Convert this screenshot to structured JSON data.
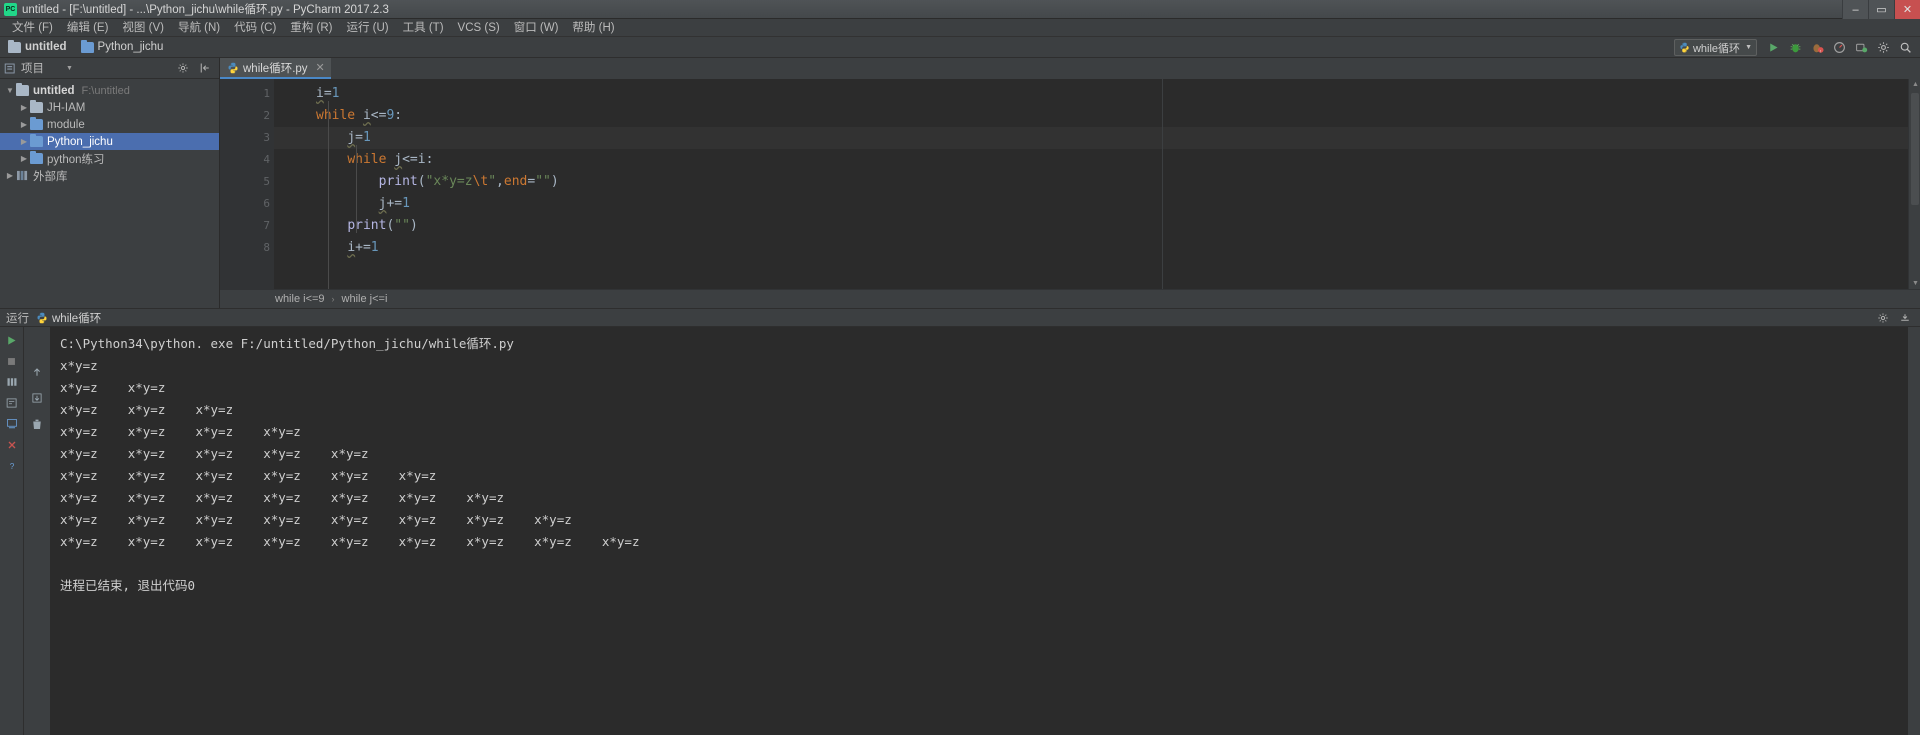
{
  "window": {
    "title": "untitled - [F:\\untitled] - ...\\Python_jichu\\while循环.py - PyCharm 2017.2.3",
    "app_icon": "pycharm-logo-icon",
    "minimize": "–",
    "maximize": "▭",
    "close": "✕"
  },
  "menubar": {
    "items": [
      {
        "label": "文件 (F)",
        "name": "menu-file"
      },
      {
        "label": "编辑 (E)",
        "name": "menu-edit"
      },
      {
        "label": "视图 (V)",
        "name": "menu-view"
      },
      {
        "label": "导航 (N)",
        "name": "menu-navigate"
      },
      {
        "label": "代码 (C)",
        "name": "menu-code"
      },
      {
        "label": "重构 (R)",
        "name": "menu-refactor"
      },
      {
        "label": "运行 (U)",
        "name": "menu-run"
      },
      {
        "label": "工具 (T)",
        "name": "menu-tools"
      },
      {
        "label": "VCS (S)",
        "name": "menu-vcs"
      },
      {
        "label": "窗口 (W)",
        "name": "menu-window"
      },
      {
        "label": "帮助 (H)",
        "name": "menu-help"
      }
    ]
  },
  "navbar": {
    "crumbs": [
      {
        "label": "untitled",
        "icon": "folder-icon"
      },
      {
        "label": "Python_jichu",
        "icon": "source-folder-icon"
      }
    ],
    "run_config": {
      "label": "while循环",
      "icon": "python-file-icon",
      "caret": "▼"
    },
    "actions": [
      {
        "name": "run-button",
        "glyph": "▶"
      },
      {
        "name": "debug-button",
        "glyph": "bug"
      },
      {
        "name": "coverage-button",
        "glyph": "coverage"
      },
      {
        "name": "profile-button",
        "glyph": "profile"
      },
      {
        "name": "attach-button",
        "glyph": "attach"
      },
      {
        "name": "settings-button",
        "glyph": "gear"
      },
      {
        "name": "search-button",
        "glyph": "magnifier"
      }
    ]
  },
  "project_panel": {
    "header": {
      "title": "项目",
      "icon": "project-view-icon",
      "caret": "▼",
      "gear": "⚙",
      "collapse": "⇥"
    },
    "tree": [
      {
        "label": "untitled",
        "sub": "F:\\untitled",
        "icon": "folder-icon",
        "arrow": "▼",
        "depth": 0,
        "selected": false,
        "bold": true
      },
      {
        "label": "JH-IAM",
        "sub": "",
        "icon": "folder-icon",
        "arrow": "▶",
        "depth": 1,
        "selected": false,
        "bold": false
      },
      {
        "label": "module",
        "sub": "",
        "icon": "source-folder-icon",
        "arrow": "▶",
        "depth": 1,
        "selected": false,
        "bold": false
      },
      {
        "label": "Python_jichu",
        "sub": "",
        "icon": "source-folder-icon",
        "arrow": "▶",
        "depth": 1,
        "selected": true,
        "bold": false
      },
      {
        "label": "python练习",
        "sub": "",
        "icon": "source-folder-icon",
        "arrow": "▶",
        "depth": 1,
        "selected": false,
        "bold": false
      },
      {
        "label": "外部库",
        "sub": "",
        "icon": "library-icon",
        "arrow": "▶",
        "depth": 0,
        "selected": false,
        "bold": false
      }
    ]
  },
  "editor": {
    "tabs": [
      {
        "label": "while循环.py",
        "icon": "python-file-icon",
        "close": "✕",
        "active": true
      }
    ],
    "line_numbers": [
      "1",
      "2",
      "3",
      "4",
      "5",
      "6",
      "7",
      "8"
    ],
    "lines": [
      {
        "n": 1,
        "indent": 0,
        "text": "i=1"
      },
      {
        "n": 2,
        "indent": 0,
        "text": "while i<=9:"
      },
      {
        "n": 3,
        "indent": 1,
        "text": "j=1"
      },
      {
        "n": 4,
        "indent": 1,
        "text": "while j<=i:"
      },
      {
        "n": 5,
        "indent": 2,
        "text": "print(\"x*y=z\\t\",end=\"\")"
      },
      {
        "n": 6,
        "indent": 2,
        "text": "j+=1"
      },
      {
        "n": 7,
        "indent": 1,
        "text": "print(\"\")"
      },
      {
        "n": 8,
        "indent": 1,
        "text": "i+=1"
      }
    ],
    "highlighted_line": 3,
    "bulb_line": 5,
    "breadcrumbs": [
      "while i<=9",
      "while j<=i"
    ],
    "breadcrumb_separator": "›"
  },
  "run_window": {
    "label": "运行",
    "tab_label": "while循环",
    "tab_icon": "python-file-icon",
    "gear": "⚙",
    "minimize": "⊥",
    "toolbar_left": [
      {
        "name": "rerun-button",
        "glyph": "▶"
      },
      {
        "name": "stop-button",
        "glyph": "■"
      },
      {
        "name": "print-button",
        "glyph": "grid"
      },
      {
        "name": "console-button",
        "glyph": "console"
      },
      {
        "name": "soft-wrap-button",
        "glyph": "wrap"
      },
      {
        "name": "scroll-end-button",
        "glyph": "scroll"
      },
      {
        "name": "close-tab-button",
        "glyph": "✕"
      },
      {
        "name": "help-button",
        "glyph": "?"
      }
    ],
    "toolbar_right": [
      {
        "name": "up-stack-button",
        "glyph": "↑"
      },
      {
        "name": "down-stack-button",
        "glyph": "↓"
      },
      {
        "name": "trash-button",
        "glyph": "trash"
      }
    ],
    "console_lines": [
      "C:\\Python34\\python. exe F:/untitled/Python_jichu/while循环.py",
      "x*y=z",
      "x*y=z    x*y=z",
      "x*y=z    x*y=z    x*y=z",
      "x*y=z    x*y=z    x*y=z    x*y=z",
      "x*y=z    x*y=z    x*y=z    x*y=z    x*y=z",
      "x*y=z    x*y=z    x*y=z    x*y=z    x*y=z    x*y=z",
      "x*y=z    x*y=z    x*y=z    x*y=z    x*y=z    x*y=z    x*y=z",
      "x*y=z    x*y=z    x*y=z    x*y=z    x*y=z    x*y=z    x*y=z    x*y=z",
      "x*y=z    x*y=z    x*y=z    x*y=z    x*y=z    x*y=z    x*y=z    x*y=z    x*y=z",
      "",
      "进程已结束, 退出代码0"
    ]
  },
  "colors": {
    "bg_chrome": "#3c3f41",
    "bg_editor": "#2b2b2b",
    "selection": "#4b6eaf",
    "accent_tab": "#4a88c7",
    "keyword": "#cc7832",
    "string": "#6a8759",
    "number": "#6897bb",
    "function": "#b5b6e3",
    "text": "#a9b7c6"
  }
}
